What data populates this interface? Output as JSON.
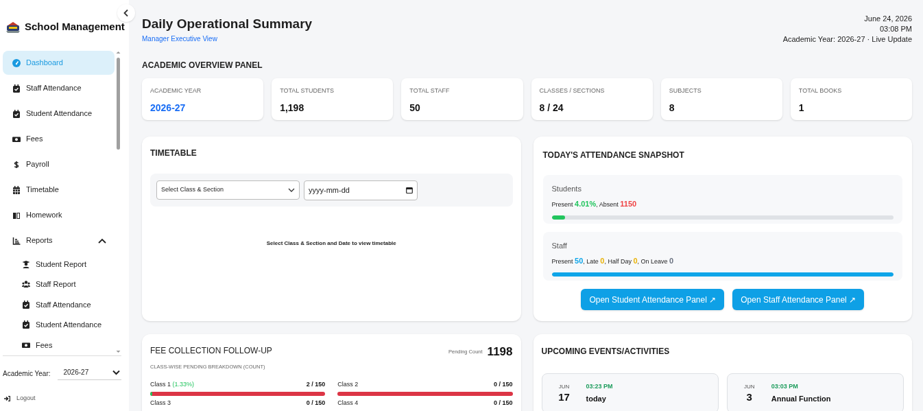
{
  "sidebar": {
    "brand": "School Management",
    "nav": [
      {
        "label": "Dashboard",
        "selected": true
      },
      {
        "label": "Staff Attendance",
        "selected": false
      },
      {
        "label": "Student Attendance",
        "selected": false
      },
      {
        "label": "Fees",
        "selected": false
      },
      {
        "label": "Payroll",
        "selected": false
      },
      {
        "label": "Timetable",
        "selected": false
      },
      {
        "label": "Homework",
        "selected": false
      },
      {
        "label": "Reports",
        "selected": false,
        "expanded": true,
        "children": [
          {
            "label": "Student Report"
          },
          {
            "label": "Staff Report"
          },
          {
            "label": "Staff Attendance"
          },
          {
            "label": "Student Attendance"
          },
          {
            "label": "Fees"
          }
        ]
      }
    ],
    "year_label": "Academic Year:",
    "year_value": "2026-27",
    "logout": "Logout"
  },
  "header": {
    "title": "Daily Operational Summary",
    "subtitle": "Manager Executive View",
    "date": "June 24, 2026",
    "time": "03:08 PM",
    "status": "Academic Year: 2026-27 · Live Update"
  },
  "overview": {
    "heading": "ACADEMIC OVERVIEW PANEL",
    "stats": [
      {
        "label": "ACADEMIC YEAR",
        "value": "2026-27",
        "accent": true
      },
      {
        "label": "TOTAL STUDENTS",
        "value": "1,198",
        "accent": false
      },
      {
        "label": "TOTAL STAFF",
        "value": "50",
        "accent": false
      },
      {
        "label": "CLASSES / SECTIONS",
        "value": "8 / 24",
        "accent": false
      },
      {
        "label": "SUBJECTS",
        "value": "8",
        "accent": false
      },
      {
        "label": "TOTAL BOOKS",
        "value": "1",
        "accent": false
      }
    ]
  },
  "timetable": {
    "title": "TIMETABLE",
    "class_select": "Select Class & Section",
    "date_placeholder": "yyyy-mm-dd",
    "empty_message": "Select Class & Section and Date to view timetable"
  },
  "attendance": {
    "title": "TODAY'S ATTENDANCE SNAPSHOT",
    "groups": [
      {
        "label": "Students",
        "color": "#22c55e",
        "level": 0.04,
        "parts": [
          {
            "text": "Present "
          },
          {
            "text": "4.01%",
            "color": "#22c55e"
          },
          {
            "text": ", Absent "
          },
          {
            "text": "1150",
            "color": "#ef4444"
          }
        ]
      },
      {
        "label": "Staff",
        "color": "#0ea5e9",
        "level": 1,
        "parts": [
          {
            "text": "Present "
          },
          {
            "text": "50",
            "color": "#0ea5e9"
          },
          {
            "text": ", Late "
          },
          {
            "text": "0",
            "color": "#eab308"
          },
          {
            "text": ", Half Day "
          },
          {
            "text": "0",
            "color": "#eab308"
          },
          {
            "text": ", On Leave "
          },
          {
            "text": "0",
            "color": "#6b7280"
          }
        ]
      }
    ],
    "buttons": [
      "Open Student Attendance Panel ↗",
      "Open Staff Attendance Panel ↗"
    ]
  },
  "fees": {
    "title": "FEE COLLECTION FOLLOW-UP",
    "subtitle": "CLASS-WISE PENDING BREAKDOWN (COUNT)",
    "pending_label": "Pending Count",
    "pending_count": "1198",
    "classes": [
      {
        "label": "Class 1",
        "percent": "(1.33%)",
        "count": "2 / 150",
        "level": 0.0133
      },
      {
        "label": "Class 2",
        "count": "0 / 150",
        "level": 0
      },
      {
        "label": "Class 3",
        "count": "0 / 150"
      },
      {
        "label": "Class 4",
        "count": "0 / 150"
      }
    ]
  },
  "events": {
    "title": "UPCOMING EVENTS/ACTIVITIES",
    "items": [
      {
        "month": "JUN",
        "day": "17",
        "time": "03:23 PM",
        "title": "today"
      },
      {
        "month": "JUN",
        "day": "3",
        "time": "03:03 PM",
        "title": "Annual Function"
      }
    ]
  }
}
